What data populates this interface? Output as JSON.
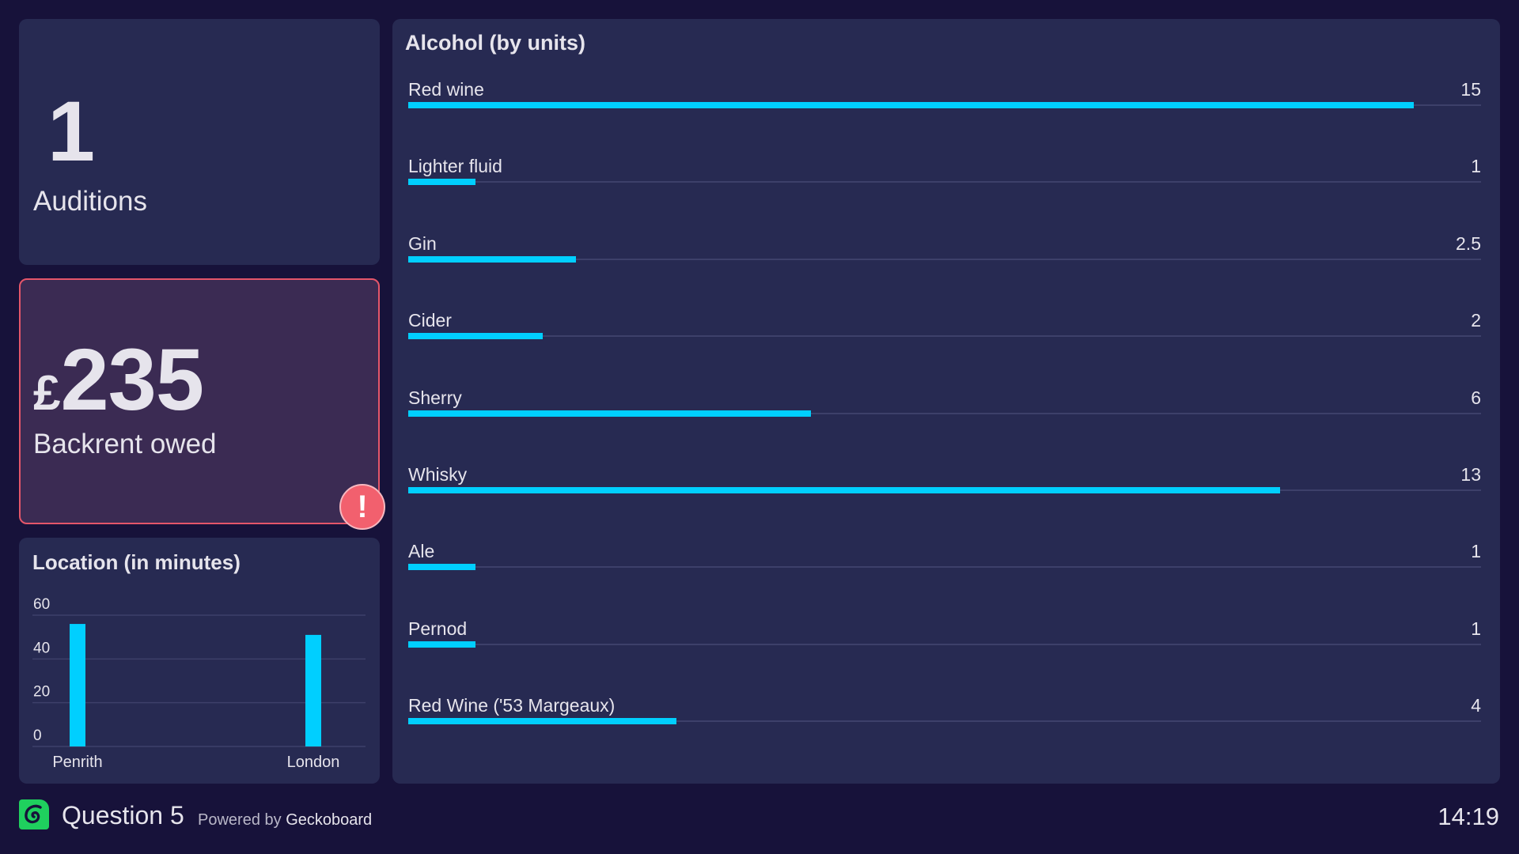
{
  "colors": {
    "background": "#17123a",
    "panel": "#272a52",
    "alert_panel": "#3b2b53",
    "alert_border": "#e5566a",
    "alert_badge": "#f2606e",
    "bar": "#00cfff",
    "text": "#e6e4ec",
    "logo": "#1fd05e"
  },
  "widgets": {
    "auditions": {
      "value": "1",
      "label": "Auditions"
    },
    "backrent": {
      "currency": "£",
      "value": "235",
      "label": "Backrent owed",
      "status": "alert",
      "alert_icon": "exclamation-icon",
      "alert_glyph": "!"
    },
    "location": {
      "title": "Location (in minutes)"
    },
    "alcohol": {
      "title": "Alcohol (by units)",
      "scale_max": 16,
      "rows": [
        {
          "label": "Red wine",
          "value": 15,
          "display": "15"
        },
        {
          "label": "Lighter fluid",
          "value": 1,
          "display": "1"
        },
        {
          "label": "Gin",
          "value": 2.5,
          "display": "2.5"
        },
        {
          "label": "Cider",
          "value": 2,
          "display": "2"
        },
        {
          "label": "Sherry",
          "value": 6,
          "display": "6"
        },
        {
          "label": "Whisky",
          "value": 13,
          "display": "13"
        },
        {
          "label": "Ale",
          "value": 1,
          "display": "1"
        },
        {
          "label": "Pernod",
          "value": 1,
          "display": "1"
        },
        {
          "label": "Red Wine ('53 Margeaux)",
          "value": 4,
          "display": "4"
        }
      ]
    }
  },
  "chart_data": [
    {
      "type": "bar",
      "title": "Location (in minutes)",
      "categories": [
        "Penrith",
        "London"
      ],
      "values": [
        56,
        51
      ],
      "xlabel": "",
      "ylabel": "",
      "ylim": [
        0,
        60
      ],
      "yticks": [
        0,
        20,
        40,
        60
      ],
      "grid": true,
      "legend": "none"
    },
    {
      "type": "bar",
      "orientation": "horizontal",
      "title": "Alcohol (by units)",
      "categories": [
        "Red wine",
        "Lighter fluid",
        "Gin",
        "Cider",
        "Sherry",
        "Whisky",
        "Ale",
        "Pernod",
        "Red Wine ('53 Margeaux)"
      ],
      "values": [
        15,
        1,
        2.5,
        2,
        6,
        13,
        1,
        1,
        4
      ],
      "xlim": [
        0,
        16
      ],
      "legend": "none"
    }
  ],
  "footer": {
    "logo_icon": "geckoboard-logo-icon",
    "title": "Question 5",
    "powered_prefix": "Powered by",
    "powered_brand": "Geckoboard",
    "clock": "14:19"
  }
}
